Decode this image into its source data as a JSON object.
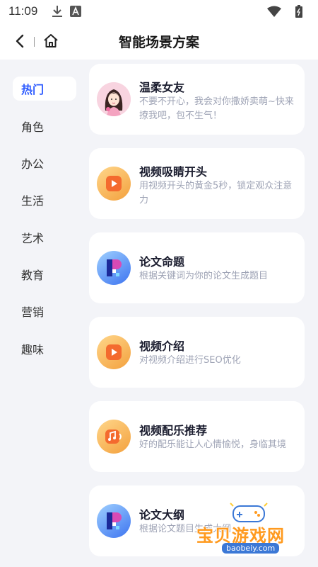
{
  "status_bar": {
    "time": "11:09",
    "icons": [
      "download-icon",
      "a-badge-icon",
      "wifi-icon",
      "battery-icon"
    ]
  },
  "header": {
    "title": "智能场景方案"
  },
  "sidebar": {
    "items": [
      {
        "label": "热门",
        "active": true
      },
      {
        "label": "角色",
        "active": false
      },
      {
        "label": "办公",
        "active": false
      },
      {
        "label": "生活",
        "active": false
      },
      {
        "label": "艺术",
        "active": false
      },
      {
        "label": "教育",
        "active": false
      },
      {
        "label": "营销",
        "active": false
      },
      {
        "label": "趣味",
        "active": false
      }
    ]
  },
  "cards": [
    {
      "title": "温柔女友",
      "desc": "不要不开心，我会对你撒娇卖萌~快来撩我吧，包不生气！",
      "icon": "girlfriend-avatar-icon"
    },
    {
      "title": "视频吸睛开头",
      "desc": "用视频开头的黄金5秒，锁定观众注意力",
      "icon": "video-play-icon"
    },
    {
      "title": "论文命题",
      "desc": "根据关键词为你的论文生成题目",
      "icon": "paper-p-icon"
    },
    {
      "title": "视频介绍",
      "desc": "对视频介绍进行SEO优化",
      "icon": "video-play-icon"
    },
    {
      "title": "视频配乐推荐",
      "desc": "好的配乐能让人心情愉悦，身临其境",
      "icon": "music-note-icon"
    },
    {
      "title": "论文大纲",
      "desc": "根据论文题目生成大纲",
      "icon": "paper-p-icon"
    }
  ],
  "watermark": {
    "text": "宝贝游戏网",
    "url": "baobeiy.com"
  },
  "colors": {
    "accent": "#2d5bff",
    "background": "#f3f4f8",
    "card": "#ffffff",
    "orange_icon": "#f3a13e",
    "blue_icon": "#3d74f0"
  }
}
